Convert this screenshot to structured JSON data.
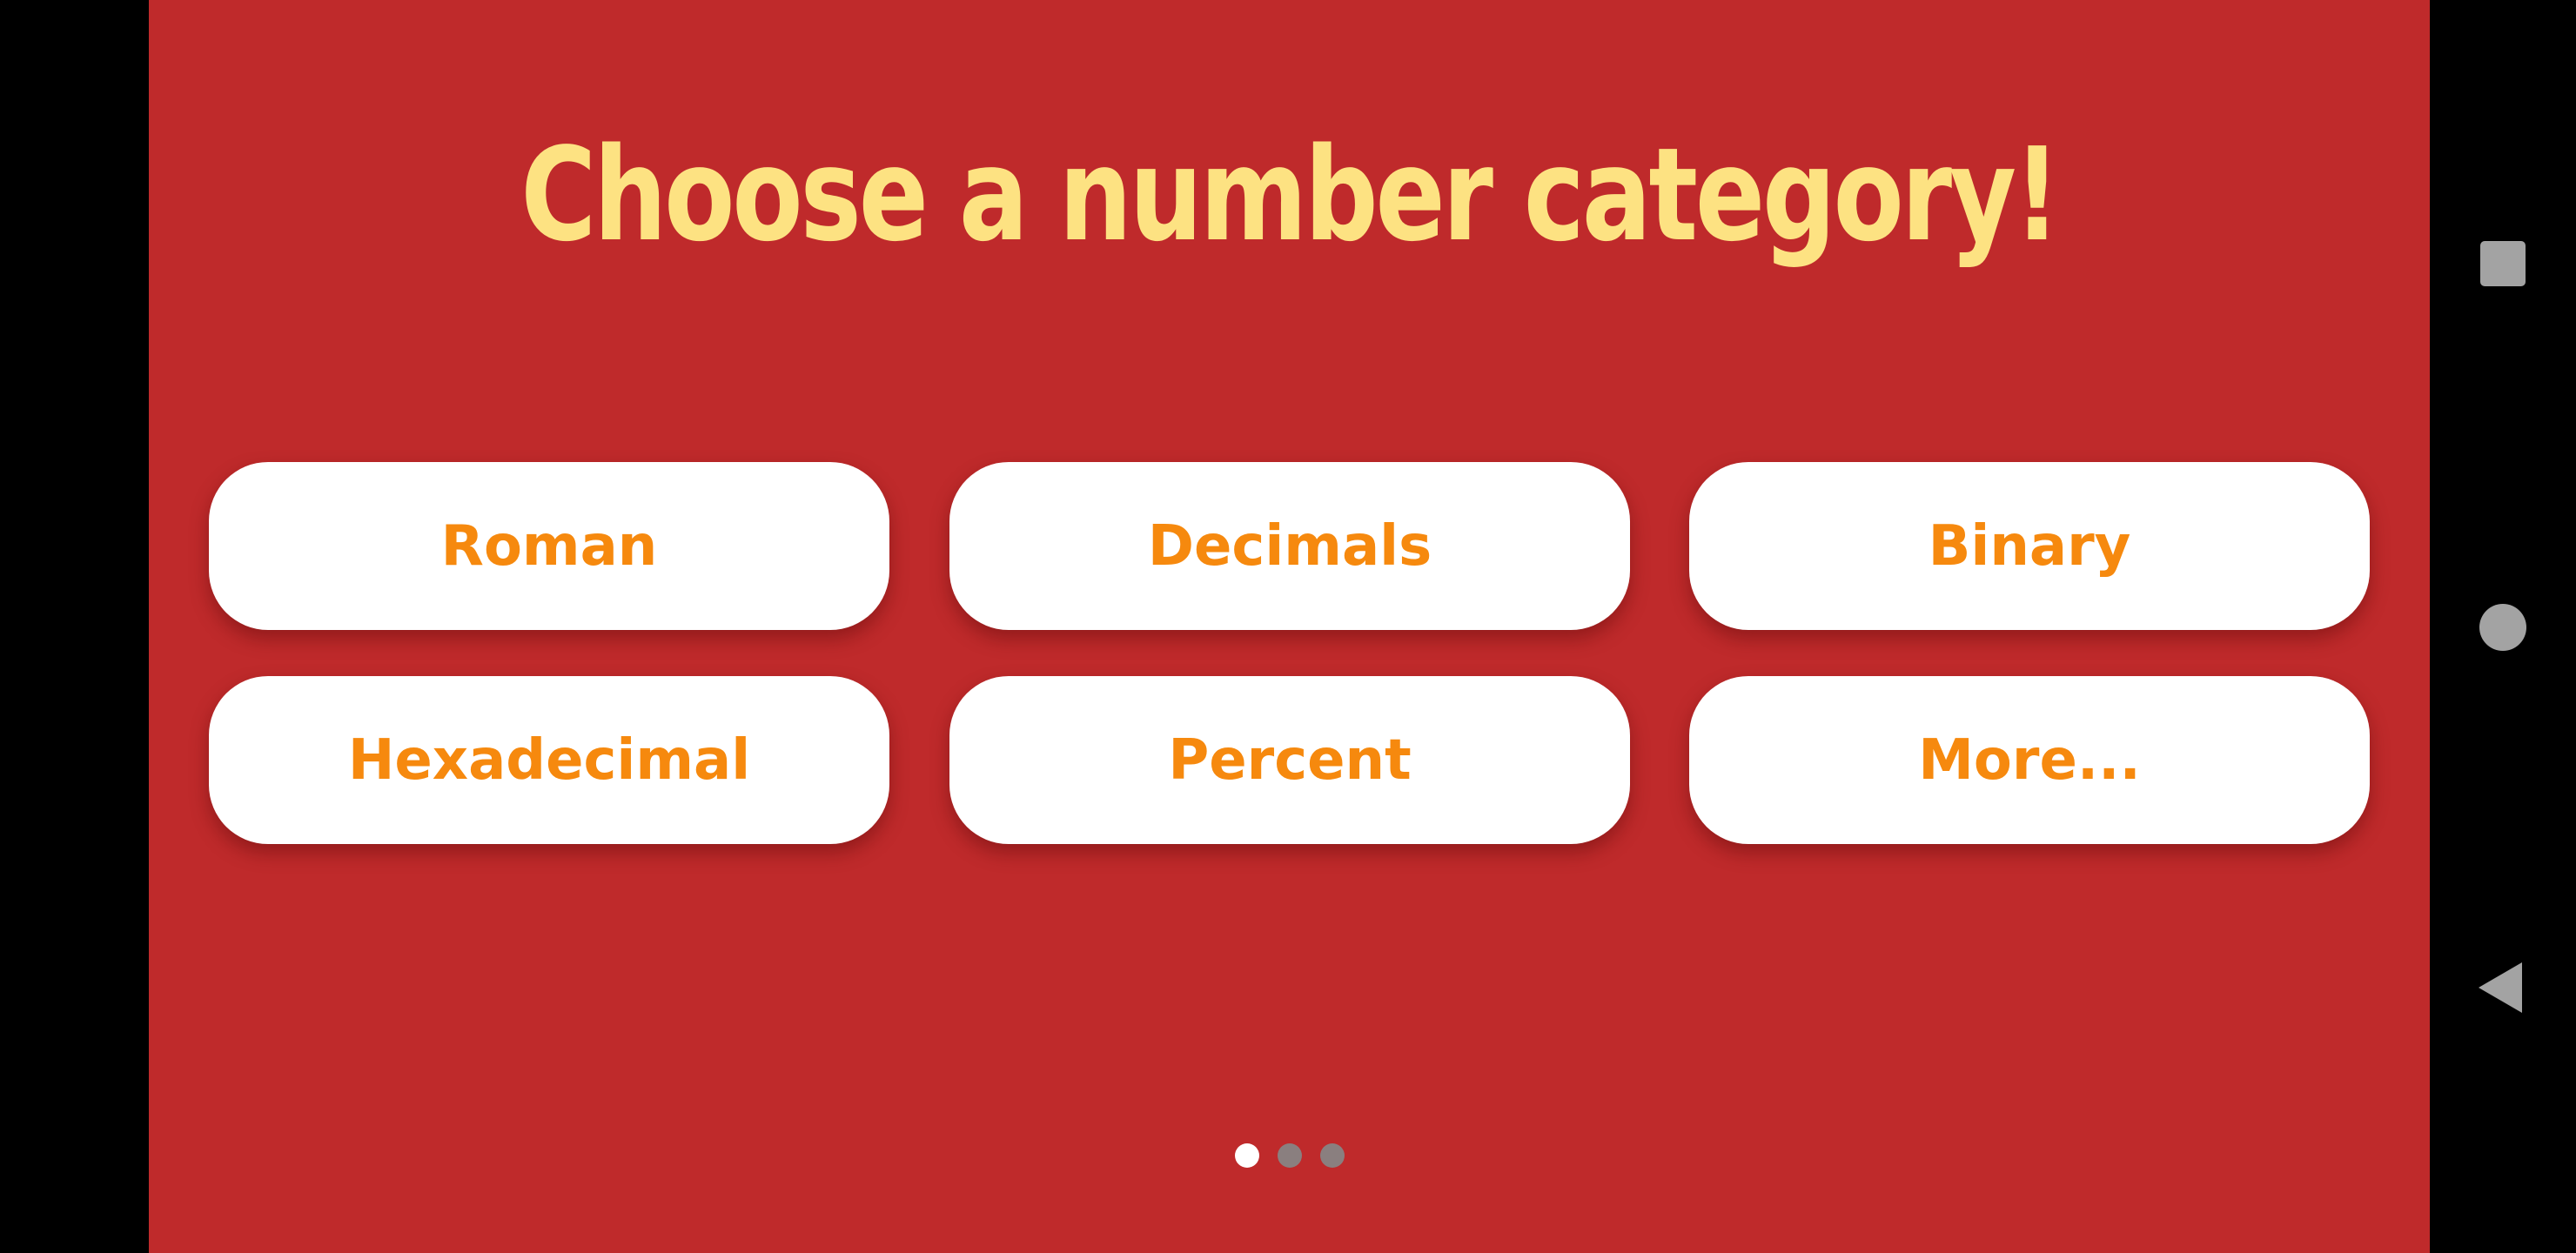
{
  "screen": {
    "title": "Choose a number category!",
    "background_color": "#BF2A2B",
    "title_color": "#FDE282",
    "button_text_color": "#F6890E"
  },
  "categories": [
    {
      "label": "Roman"
    },
    {
      "label": "Decimals"
    },
    {
      "label": "Binary"
    },
    {
      "label": "Hexadecimal"
    },
    {
      "label": "Percent"
    },
    {
      "label": "More..."
    }
  ],
  "pager": {
    "page_count": 3,
    "current_page": 1
  },
  "system_nav": {
    "buttons": [
      "recents-icon",
      "home-icon",
      "back-icon"
    ]
  }
}
